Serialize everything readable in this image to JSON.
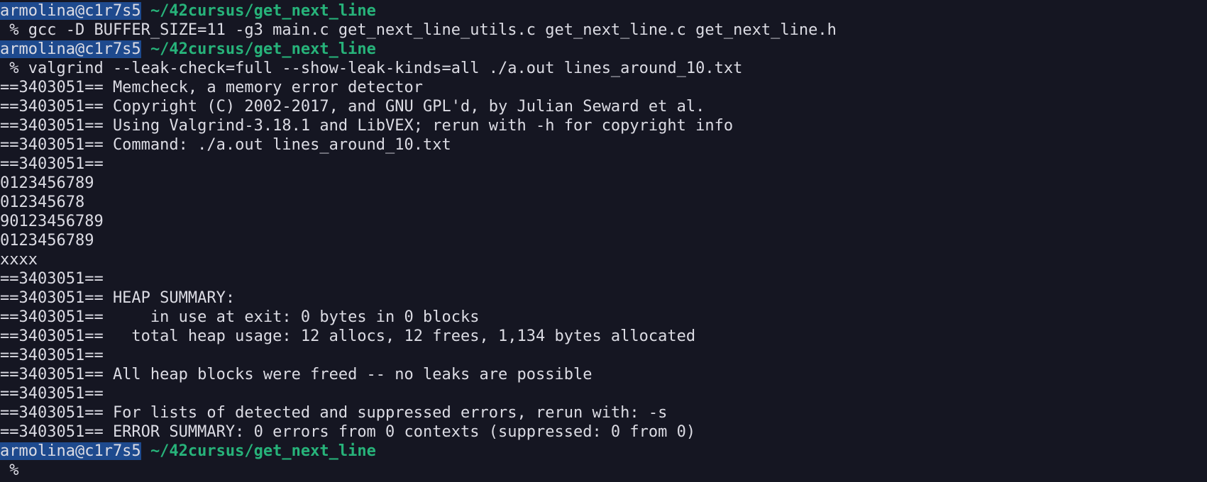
{
  "prompt": {
    "user_host": "armolina@c1r7s5",
    "path": "~/42cursus/get_next_line"
  },
  "commands": [
    " % gcc -D BUFFER_SIZE=11 -g3 main.c get_next_line_utils.c get_next_line.c get_next_line.h",
    " % valgrind --leak-check=full --show-leak-kinds=all ./a.out lines_around_10.txt",
    " %"
  ],
  "output": [
    "==3403051== Memcheck, a memory error detector",
    "==3403051== Copyright (C) 2002-2017, and GNU GPL'd, by Julian Seward et al.",
    "==3403051== Using Valgrind-3.18.1 and LibVEX; rerun with -h for copyright info",
    "==3403051== Command: ./a.out lines_around_10.txt",
    "==3403051==",
    "0123456789",
    "012345678",
    "90123456789",
    "0123456789",
    "xxxx",
    "==3403051==",
    "==3403051== HEAP SUMMARY:",
    "==3403051==     in use at exit: 0 bytes in 0 blocks",
    "==3403051==   total heap usage: 12 allocs, 12 frees, 1,134 bytes allocated",
    "==3403051==",
    "==3403051== All heap blocks were freed -- no leaks are possible",
    "==3403051==",
    "==3403051== For lists of detected and suppressed errors, rerun with: -s",
    "==3403051== ERROR SUMMARY: 0 errors from 0 contexts (suppressed: 0 from 0)"
  ]
}
